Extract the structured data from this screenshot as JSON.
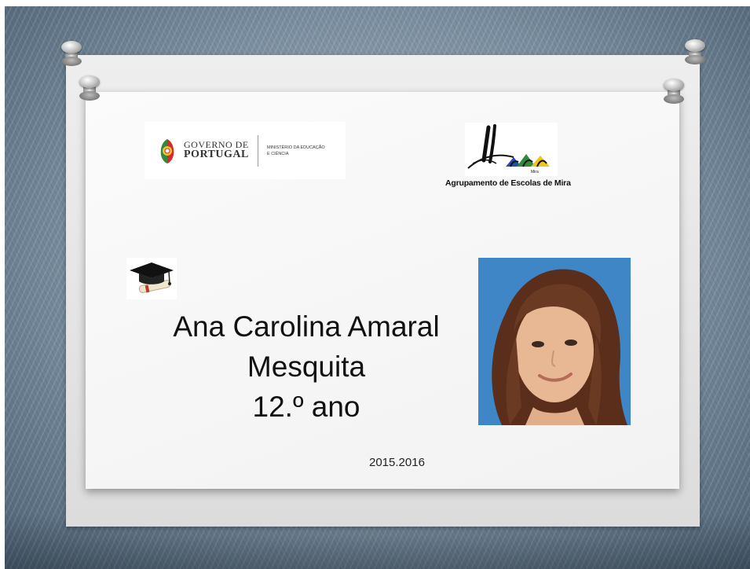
{
  "logos": {
    "government": {
      "line1": "GOVERNO DE",
      "line2": "PORTUGAL",
      "ministry_line1": "MINISTÉRIO DA EDUCAÇÃO",
      "ministry_line2": "E CIÊNCIA"
    },
    "school": {
      "caption": "Agrupamento de Escolas de Mira",
      "small_text": "Mira"
    }
  },
  "student": {
    "name_line1": "Ana Carolina Amaral",
    "name_line2": "Mesquita",
    "grade": "12.º ano"
  },
  "school_year": "2015.2016",
  "icons": [
    "graduation-cap-diploma-icon",
    "thumbtack-icon"
  ],
  "colors": {
    "photo_background": "#3f86c7",
    "card": "#f4f4f4"
  }
}
